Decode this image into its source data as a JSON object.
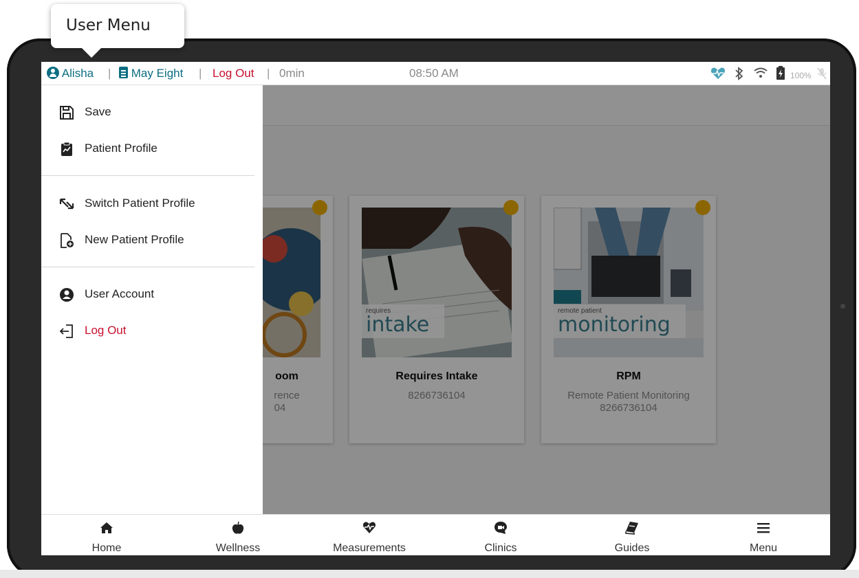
{
  "tooltip": {
    "label": "User Menu"
  },
  "statusbar": {
    "user_name": "Alisha",
    "patient_name": "May Eight",
    "logout": "Log Out",
    "duration": "0min",
    "time": "08:50 AM",
    "battery": "100%",
    "separator": "|"
  },
  "drawer": {
    "items": [
      {
        "label": "Save",
        "icon": "save-icon"
      },
      {
        "label": "Patient Profile",
        "icon": "clipboard-chart-icon"
      },
      {
        "label": "Switch Patient Profile",
        "icon": "switch-arrows-icon"
      },
      {
        "label": "New Patient Profile",
        "icon": "new-file-icon"
      },
      {
        "label": "User Account",
        "icon": "user-account-icon"
      },
      {
        "label": "Log Out",
        "icon": "log-out-icon"
      }
    ]
  },
  "cards": [
    {
      "title": "oom",
      "line1": "rence",
      "line2": "04"
    },
    {
      "title": "Requires Intake",
      "line1": "8266736104",
      "line2": "",
      "img_small": "requires",
      "img_big": "intake"
    },
    {
      "title": "RPM",
      "line1": "Remote Patient Monitoring",
      "line2": "8266736104",
      "img_small": "remote patient",
      "img_big": "monitoring"
    }
  ],
  "bottomnav": {
    "items": [
      {
        "label": "Home",
        "icon": "home-icon"
      },
      {
        "label": "Wellness",
        "icon": "apple-icon"
      },
      {
        "label": "Measurements",
        "icon": "heart-pulse-icon"
      },
      {
        "label": "Clinics",
        "icon": "video-chat-icon"
      },
      {
        "label": "Guides",
        "icon": "book-icon"
      },
      {
        "label": "Menu",
        "icon": "hamburger-menu-icon"
      }
    ]
  },
  "colors": {
    "accent": "#0d6e82",
    "logout": "#c8102e",
    "badge": "#f0b000"
  }
}
